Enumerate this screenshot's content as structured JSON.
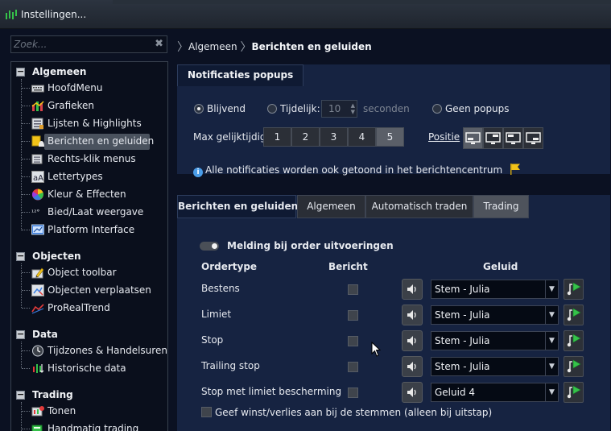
{
  "window": {
    "title": "Instellingen..."
  },
  "search": {
    "placeholder": "Zoek..."
  },
  "tree": {
    "categories": [
      {
        "label": "Algemeen",
        "items": [
          "HoofdMenu",
          "Grafieken",
          "Lijsten & Highlights",
          "Berichten en geluiden",
          "Rechts-klik menus",
          "Lettertypes",
          "Kleur & Effecten",
          "Bied/Laat weergave",
          "Platform Interface"
        ]
      },
      {
        "label": "Objecten",
        "items": [
          "Object toolbar",
          "Objecten verplaatsen",
          "ProRealTrend"
        ]
      },
      {
        "label": "Data",
        "items": [
          "Tijdzones & Handelsuren",
          "Historische data"
        ]
      },
      {
        "label": "Trading",
        "items": [
          "Tonen",
          "Handmatig trading"
        ]
      }
    ],
    "selected": "Berichten en geluiden",
    "icons": {
      "bied_prefix": "¹²°"
    }
  },
  "breadcrumb": {
    "level1": "Algemeen",
    "level2": "Berichten en geluiden"
  },
  "notif": {
    "tab": "Notificaties popups",
    "radio_persistent": "Blijvend",
    "radio_temporary": "Tijdelijk:",
    "temp_value": "10",
    "temp_unit": "seconden",
    "radio_none": "Geen popups",
    "selected_radio": "Blijvend",
    "max_label": "Max gelijktijdig:",
    "max_options": [
      "1",
      "2",
      "3",
      "4",
      "5"
    ],
    "max_selected": "5",
    "position_label": "Positie",
    "info_text": "Alle notificaties worden ook getoond in het berichtencentrum"
  },
  "sounds": {
    "tabs": [
      "Berichten en geluiden",
      "Algemeen",
      "Automatisch traden",
      "Trading"
    ],
    "active_tab": "Trading",
    "toggle_label": "Melding bij order uitvoeringen",
    "col_ordertype": "Ordertype",
    "col_bericht": "Bericht",
    "col_geluid": "Geluid",
    "rows": [
      {
        "label": "Bestens",
        "sound": "Stem - Julia"
      },
      {
        "label": "Limiet",
        "sound": "Stem - Julia"
      },
      {
        "label": "Stop",
        "sound": "Stem - Julia"
      },
      {
        "label": "Trailing stop",
        "sound": "Stem - Julia"
      },
      {
        "label": "Stop met limiet bescherming",
        "sound": "Geluid 4"
      }
    ],
    "bottom_checkbox": "Geef winst/verlies aan bij de stemmen (alleen bij uitstap)"
  },
  "colors": {
    "panel": "#162341",
    "background": "#0b1122",
    "accent_blue": "#4a9de8",
    "flag": "#f2c318"
  }
}
